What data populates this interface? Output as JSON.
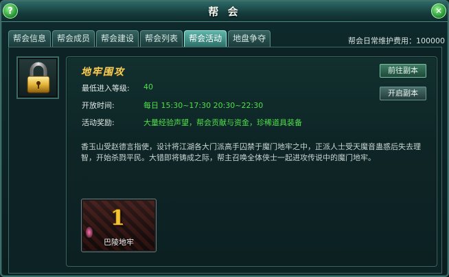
{
  "window": {
    "title": "帮 会",
    "help_glyph": "?",
    "close_glyph": "✕"
  },
  "tabs": [
    {
      "label": "帮会信息",
      "active": false
    },
    {
      "label": "帮会成员",
      "active": false
    },
    {
      "label": "帮会建设",
      "active": false
    },
    {
      "label": "帮会列表",
      "active": false
    },
    {
      "label": "帮会活动",
      "active": true
    },
    {
      "label": "地盘争夺",
      "active": false
    }
  ],
  "upkeep": "帮会日常维护费用：100000",
  "activity": {
    "icon": "padlock-icon",
    "name": "地牢围攻",
    "min_level_label": "最低进入等级:",
    "min_level_value": "40",
    "open_time_label": "开放时间:",
    "open_time_value": "每日 15:30~17:30 20:30~22:30",
    "reward_label": "活动奖励:",
    "reward_value": "大量经验声望，帮会贡献与资金，珍稀道具装备",
    "description": "香玉山受赵德言指使，设计将江湖各大门派高手囚禁于魔门地牢之中，正派人士受天魔音蛊惑后失去理智，开始杀戮平民。大错即将铸成之际，帮主召唤全体侠士一起进攻传说中的魔门地牢。"
  },
  "buttons": {
    "goto_dungeon": "前往副本",
    "open_dungeon": "开启副本"
  },
  "dungeon": {
    "number": "1",
    "name": "巴陵地牢"
  },
  "colors": {
    "accent_gold": "#f3d060",
    "value_green": "#4fe04a",
    "frame_teal": "#3f6f6a"
  }
}
